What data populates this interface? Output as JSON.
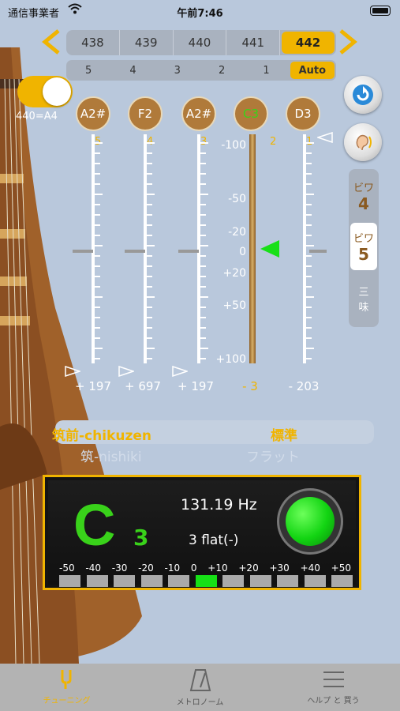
{
  "status": {
    "carrier": "通信事業者",
    "time": "午前7:46"
  },
  "pitch": {
    "options": [
      "438",
      "439",
      "440",
      "441",
      "442"
    ],
    "selected_index": 4
  },
  "stage": {
    "options": [
      "5",
      "4",
      "3",
      "2",
      "1",
      "Auto"
    ],
    "selected_index": 5
  },
  "toggle": {
    "label": "440=A4",
    "on": true
  },
  "strings": [
    {
      "note": "A2#",
      "num": "5",
      "offset": "+ 197",
      "active": false
    },
    {
      "note": "F2",
      "num": "4",
      "offset": "+ 697",
      "active": false
    },
    {
      "note": "A2#",
      "num": "3",
      "offset": "+ 197",
      "active": false
    },
    {
      "note": "C3",
      "num": "2",
      "offset": "- 3",
      "active": true
    },
    {
      "note": "D3",
      "num": "1",
      "offset": "- 203",
      "active": false
    }
  ],
  "cent_scale": [
    "-100",
    "-50",
    "-20",
    "0",
    "+20",
    "+50",
    "+100"
  ],
  "side_panel": [
    {
      "top": "ビワ",
      "bottom": "4"
    },
    {
      "top": "ビワ",
      "bottom": "5"
    },
    {
      "top": "三",
      "bottom": "味"
    }
  ],
  "style": {
    "school": "筑前-chikuzen",
    "school2": "筑-nishiki",
    "tuning": "標準",
    "tuning2": "フラット"
  },
  "tuner": {
    "note": "C",
    "octave": "3",
    "frequency": "131.19 Hz",
    "deviation": "3  flat(-)",
    "meter_labels": [
      "-50",
      "-40",
      "-30",
      "-20",
      "-10",
      "0",
      "+10",
      "+20",
      "+30",
      "+40",
      "+50"
    ],
    "meter_active_index": 5
  },
  "tabs": [
    {
      "label": "チューニング",
      "active": true
    },
    {
      "label": "メトロノーム",
      "active": false
    },
    {
      "label": "ヘルプ と 買う",
      "active": false
    }
  ],
  "colors": {
    "accent": "#f0b400",
    "in_tune": "#39d21a",
    "background": "#b9c8dc"
  }
}
